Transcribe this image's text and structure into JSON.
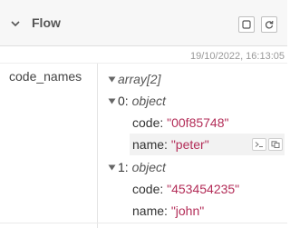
{
  "header": {
    "title": "Flow",
    "collapse_icon": "chevron-down-icon",
    "buttons": [
      {
        "name": "copy-button",
        "icon": "square-icon"
      },
      {
        "name": "refresh-button",
        "icon": "refresh-icon"
      }
    ]
  },
  "timestamp": "19/10/2022, 16:13:05",
  "property": {
    "name": "code_names",
    "root_label": "array[2]",
    "items": [
      {
        "index_label": "0: ",
        "type_label": "object",
        "fields": [
          {
            "key": "code: ",
            "value": "\"00f85748\""
          },
          {
            "key": "name: ",
            "value": "\"peter\""
          }
        ]
      },
      {
        "index_label": "1: ",
        "type_label": "object",
        "fields": [
          {
            "key": "code: ",
            "value": "\"453454235\""
          },
          {
            "key": "name: ",
            "value": "\"john\""
          }
        ]
      }
    ]
  },
  "colors": {
    "string_value": "#b32d58",
    "header_bg": "#f7f7f7",
    "timestamp_text": "#999999"
  }
}
